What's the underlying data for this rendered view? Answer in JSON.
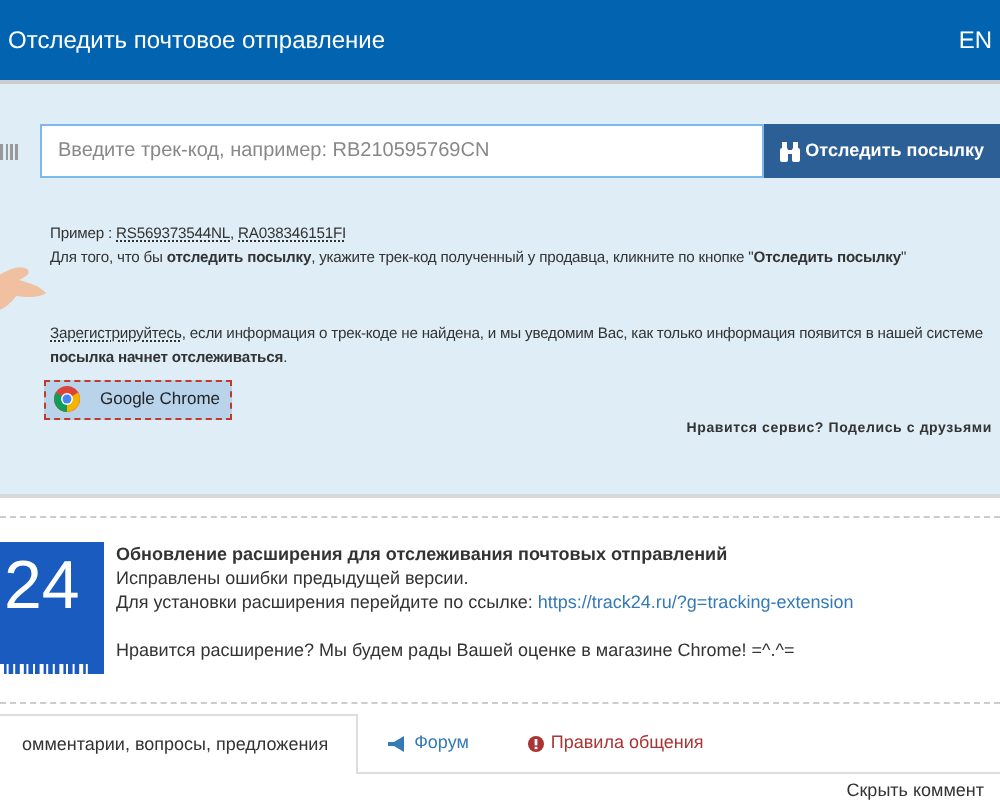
{
  "header": {
    "title": "Отследить почтовое отправление",
    "language": "EN"
  },
  "search": {
    "placeholder": "Введите трек-код, например: RB210595769CN",
    "button": "Отследить посылку"
  },
  "example": {
    "label": "Пример :",
    "separator": ",",
    "codes": [
      "RS569373544NL",
      "RA038346151FI"
    ]
  },
  "instruction": "Для того, что бы **отследить посылку**, укажите трек-код полученный у продавца, кликните по кнопке \"**Отследить посылку**\"",
  "register": {
    "link": "Зарегистрируйтесь",
    "text": ", если информация о трек-коде не найдена, и мы уведомим Вас, как только информация появится в нашей системе",
    "bold": "посылка начнет отслеживаться",
    "end": "."
  },
  "chrome_button": "Google Chrome",
  "share": "Нравится сервис? Поделись с друзьями",
  "extension": {
    "logo": "24",
    "title": "Обновление расширения для отслеживания почтовых отправлений",
    "line1": "Исправлены ошибки предыдущей версии.",
    "line2": "Для установки расширения перейдите по ссылке:",
    "link": "https://track24.ru/?g=tracking-extension",
    "line3": "Нравится расширение? Мы будем рады Вашей оценке в магазине Chrome! =^.^="
  },
  "tabs": [
    {
      "label": "омментарии, вопросы, предложения",
      "kind": "plain",
      "selected": true
    },
    {
      "label": "Форум",
      "kind": "forum",
      "selected": false
    },
    {
      "label": "Правила общения",
      "kind": "rules",
      "selected": false
    }
  ],
  "hide_link": "Скрыть коммент"
}
